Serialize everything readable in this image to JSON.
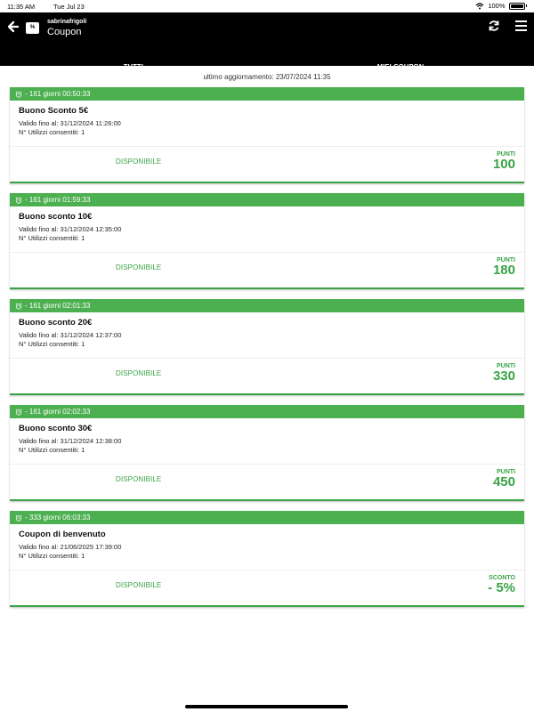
{
  "status_bar": {
    "time": "11:35 AM",
    "date": "Tue Jul 23",
    "battery": "100%"
  },
  "header": {
    "user": "sabrinafrigoli",
    "title": "Coupon"
  },
  "tabs": [
    {
      "label": "TUTTI",
      "active": true
    },
    {
      "label": "MIEI COUPON",
      "active": false
    }
  ],
  "update_text": "ultimo aggiornamento: 23/07/2024 11:35",
  "coupons": [
    {
      "countdown": "- 161 giorni 00:50:33",
      "title": "Buono Sconto 5€",
      "valid_until": "Valido fino al: 31/12/2024 11:26:00",
      "uses": "N° Utilizzi consentiti: 1",
      "status": "DISPONIBILE",
      "cost_label": "PUNTI",
      "cost_value": "100"
    },
    {
      "countdown": "- 161 giorni 01:59:33",
      "title": "Buono sconto 10€",
      "valid_until": "Valido fino al: 31/12/2024 12:35:00",
      "uses": "N° Utilizzi consentiti: 1",
      "status": "DISPONIBILE",
      "cost_label": "PUNTI",
      "cost_value": "180"
    },
    {
      "countdown": "- 161 giorni 02:01:33",
      "title": "Buono sconto 20€",
      "valid_until": "Valido fino al: 31/12/2024 12:37:00",
      "uses": "N° Utilizzi consentiti: 1",
      "status": "DISPONIBILE",
      "cost_label": "PUNTI",
      "cost_value": "330"
    },
    {
      "countdown": "- 161 giorni 02:02:33",
      "title": "Buono sconto 30€",
      "valid_until": "Valido fino al: 31/12/2024 12:38:00",
      "uses": "N° Utilizzi consentiti: 1",
      "status": "DISPONIBILE",
      "cost_label": "PUNTI",
      "cost_value": "450"
    },
    {
      "countdown": "- 333 giorni 06:03:33",
      "title": "Coupon di benvenuto",
      "valid_until": "Valido fino al: 21/06/2025 17:39:00",
      "uses": "N° Utilizzi consentiti: 1",
      "status": "DISPONIBILE",
      "cost_label": "SCONTO",
      "cost_value": "- 5%"
    }
  ],
  "colors": {
    "accent_green": "#4caf50",
    "text_green": "#3aa346",
    "header_bg": "#000000"
  },
  "icons": {
    "back": "arrow-left-icon",
    "app": "coupon-percent-icon",
    "refresh": "refresh-icon",
    "menu": "hamburger-menu-icon",
    "countdown": "alarm-clock-icon"
  }
}
